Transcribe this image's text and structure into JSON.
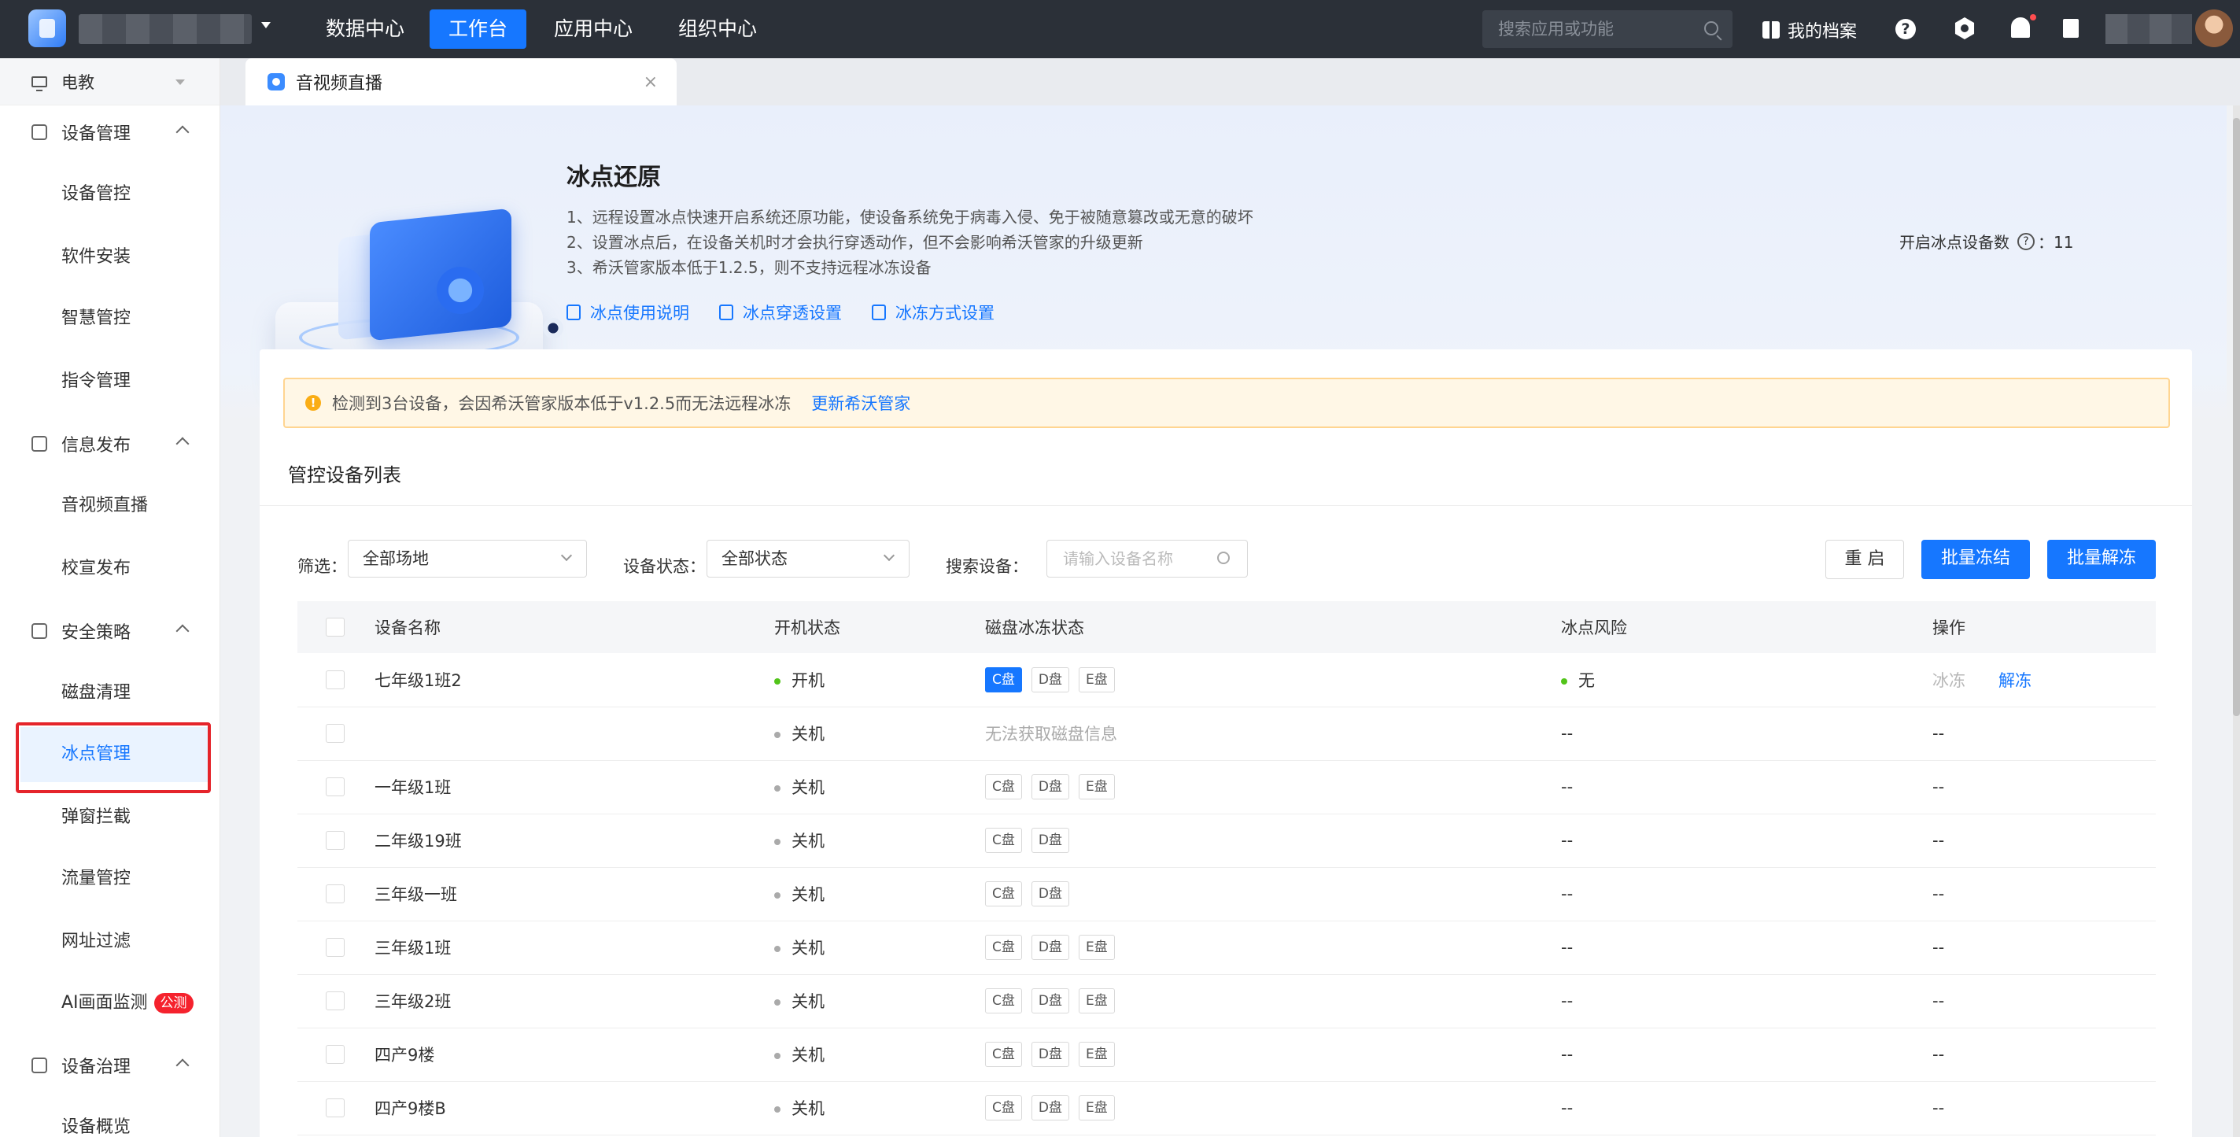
{
  "topnav": {
    "items": [
      {
        "label": "数据中心",
        "active": false
      },
      {
        "label": "工作台",
        "active": true
      },
      {
        "label": "应用中心",
        "active": false
      },
      {
        "label": "组织中心",
        "active": false
      }
    ],
    "search_placeholder": "搜索应用或功能",
    "archive_label": "我的档案",
    "help_glyph": "?"
  },
  "sidebar": {
    "scope": "电教",
    "groups": [
      {
        "label": "设备管理",
        "items": [
          "设备管控",
          "软件安装",
          "智慧管控",
          "指令管理"
        ]
      },
      {
        "label": "信息发布",
        "items": [
          "音视频直播",
          "校宣发布"
        ]
      },
      {
        "label": "安全策略",
        "items": [
          "磁盘清理",
          "冰点管理",
          "弹窗拦截",
          "流量管控",
          "网址过滤",
          "AI画面监测"
        ]
      },
      {
        "label": "设备治理",
        "items": [
          "设备概览"
        ]
      }
    ],
    "active_item": "冰点管理",
    "beta_badge": "公测"
  },
  "tabs": [
    {
      "label": "音视频直播",
      "close": "×"
    }
  ],
  "hero": {
    "title": "冰点还原",
    "lines": [
      "1、远程设置冰点快速开启系统还原功能，使设备系统免于病毒入侵、免于被随意篡改或无意的破坏",
      "2、设置冰点后，在设备关机时才会执行穿透动作，但不会影响希沃管家的升级更新",
      "3、希沃管家版本低于1.2.5，则不支持远程冰冻设备"
    ],
    "links": [
      "冰点使用说明",
      "冰点穿透设置",
      "冰冻方式设置"
    ],
    "freeze_count_label": "开启冰点设备数",
    "freeze_count_value": "：11"
  },
  "warning": {
    "text": "检测到3台设备，会因希沃管家版本低于v1.2.5而无法远程冰冻",
    "link": "更新希沃管家",
    "icon_glyph": "!"
  },
  "list": {
    "title": "管控设备列表",
    "filter_label": "筛选：",
    "site_select": "全部场地",
    "status_label": "设备状态：",
    "status_select": "全部状态",
    "search_label": "搜索设备：",
    "search_placeholder": "请输入设备名称",
    "buttons": {
      "restart": "重 启",
      "freeze": "批量冻结",
      "unfreeze": "批量解冻"
    },
    "columns": [
      "设备名称",
      "开机状态",
      "磁盘冰冻状态",
      "冰点风险",
      "操作"
    ],
    "rows": [
      {
        "name": "七年级1班2",
        "power": "开机",
        "online": true,
        "disks": [
          "C盘",
          "D盘",
          "E盘"
        ],
        "active_disk": "C盘",
        "risk": "无",
        "ops": [
          "冰冻",
          "解冻"
        ]
      },
      {
        "name": "",
        "power": "关机",
        "online": false,
        "disks": [],
        "disk_note": "无法获取磁盘信息",
        "risk": "--",
        "ops_text": "--"
      },
      {
        "name": "一年级1班",
        "power": "关机",
        "online": false,
        "disks": [
          "C盘",
          "D盘",
          "E盘"
        ],
        "risk": "--",
        "ops_text": "--"
      },
      {
        "name": "二年级19班",
        "power": "关机",
        "online": false,
        "disks": [
          "C盘",
          "D盘"
        ],
        "risk": "--",
        "ops_text": "--"
      },
      {
        "name": "三年级一班",
        "power": "关机",
        "online": false,
        "disks": [
          "C盘",
          "D盘"
        ],
        "risk": "--",
        "ops_text": "--"
      },
      {
        "name": "三年级1班",
        "power": "关机",
        "online": false,
        "disks": [
          "C盘",
          "D盘",
          "E盘"
        ],
        "risk": "--",
        "ops_text": "--"
      },
      {
        "name": "三年级2班",
        "power": "关机",
        "online": false,
        "disks": [
          "C盘",
          "D盘",
          "E盘"
        ],
        "risk": "--",
        "ops_text": "--"
      },
      {
        "name": "四产9楼",
        "power": "关机",
        "online": false,
        "disks": [
          "C盘",
          "D盘",
          "E盘"
        ],
        "risk": "--",
        "ops_text": "--"
      },
      {
        "name": "四产9楼B",
        "power": "关机",
        "online": false,
        "disks": [
          "C盘",
          "D盘",
          "E盘"
        ],
        "risk": "--",
        "ops_text": "--"
      }
    ]
  },
  "colors": {
    "primary": "#1677ff",
    "topbar": "#2b3038",
    "highlight_border": "#e5242b",
    "warn_bg": "#fff7e6"
  }
}
